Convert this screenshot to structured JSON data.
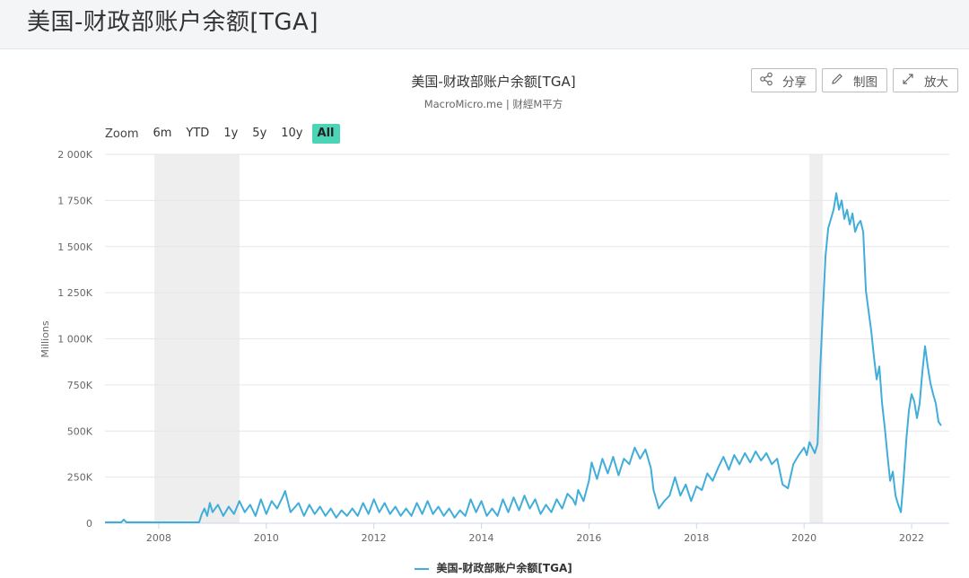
{
  "page": {
    "title": "美国-财政部账户余额[TGA]"
  },
  "toolbar": {
    "share_label": "分享",
    "draw_label": "制图",
    "enlarge_label": "放大"
  },
  "zoom": {
    "label": "Zoom",
    "options": [
      "6m",
      "YTD",
      "1y",
      "5y",
      "10y",
      "All"
    ],
    "active": "All",
    "active_color": "#4cd4b6"
  },
  "chart_data": {
    "type": "line",
    "title": "美国-财政部账户余额[TGA]",
    "subtitle": "MacroMicro.me | 财經M平方",
    "ylabel": "Millions",
    "xlabel": "",
    "ylim": [
      0,
      2000000
    ],
    "y_ticks": [
      0,
      250000,
      500000,
      750000,
      1000000,
      1250000,
      1500000,
      1750000,
      2000000
    ],
    "y_tick_labels": [
      "0",
      "250K",
      "500K",
      "750K",
      "1 000K",
      "1 250K",
      "1 500K",
      "1 750K",
      "2 000K"
    ],
    "xlim": [
      2007.0,
      2022.7
    ],
    "x_ticks": [
      2008,
      2010,
      2012,
      2014,
      2016,
      2018,
      2020,
      2022
    ],
    "x_tick_labels": [
      "2008",
      "2010",
      "2012",
      "2014",
      "2016",
      "2018",
      "2020",
      "2022"
    ],
    "grid": true,
    "legend_position": "bottom-center",
    "shaded_periods": [
      [
        2007.92,
        2009.5
      ],
      [
        2020.1,
        2020.35
      ]
    ],
    "shade_color": "#eeeeee",
    "series": [
      {
        "name": "美国-财政部账户余额[TGA]",
        "color": "#41add9",
        "points": [
          [
            2007.0,
            5000
          ],
          [
            2007.3,
            5000
          ],
          [
            2007.35,
            20000
          ],
          [
            2007.4,
            5000
          ],
          [
            2007.6,
            5000
          ],
          [
            2007.9,
            5000
          ],
          [
            2008.2,
            5000
          ],
          [
            2008.5,
            5000
          ],
          [
            2008.75,
            5000
          ],
          [
            2008.8,
            50000
          ],
          [
            2008.85,
            80000
          ],
          [
            2008.9,
            40000
          ],
          [
            2008.95,
            110000
          ],
          [
            2009.0,
            60000
          ],
          [
            2009.1,
            100000
          ],
          [
            2009.2,
            40000
          ],
          [
            2009.3,
            90000
          ],
          [
            2009.4,
            50000
          ],
          [
            2009.5,
            120000
          ],
          [
            2009.6,
            60000
          ],
          [
            2009.7,
            100000
          ],
          [
            2009.8,
            40000
          ],
          [
            2009.9,
            130000
          ],
          [
            2010.0,
            50000
          ],
          [
            2010.1,
            120000
          ],
          [
            2010.2,
            80000
          ],
          [
            2010.3,
            140000
          ],
          [
            2010.35,
            175000
          ],
          [
            2010.45,
            60000
          ],
          [
            2010.6,
            110000
          ],
          [
            2010.7,
            40000
          ],
          [
            2010.8,
            100000
          ],
          [
            2010.9,
            50000
          ],
          [
            2011.0,
            90000
          ],
          [
            2011.1,
            40000
          ],
          [
            2011.2,
            80000
          ],
          [
            2011.3,
            30000
          ],
          [
            2011.4,
            70000
          ],
          [
            2011.5,
            40000
          ],
          [
            2011.6,
            80000
          ],
          [
            2011.7,
            40000
          ],
          [
            2011.8,
            110000
          ],
          [
            2011.9,
            50000
          ],
          [
            2012.0,
            130000
          ],
          [
            2012.1,
            60000
          ],
          [
            2012.2,
            110000
          ],
          [
            2012.3,
            50000
          ],
          [
            2012.4,
            90000
          ],
          [
            2012.5,
            40000
          ],
          [
            2012.6,
            80000
          ],
          [
            2012.7,
            40000
          ],
          [
            2012.8,
            110000
          ],
          [
            2012.9,
            50000
          ],
          [
            2013.0,
            120000
          ],
          [
            2013.1,
            50000
          ],
          [
            2013.2,
            90000
          ],
          [
            2013.3,
            40000
          ],
          [
            2013.4,
            80000
          ],
          [
            2013.5,
            30000
          ],
          [
            2013.6,
            70000
          ],
          [
            2013.7,
            40000
          ],
          [
            2013.8,
            130000
          ],
          [
            2013.9,
            60000
          ],
          [
            2014.0,
            120000
          ],
          [
            2014.1,
            40000
          ],
          [
            2014.2,
            80000
          ],
          [
            2014.3,
            40000
          ],
          [
            2014.4,
            130000
          ],
          [
            2014.5,
            60000
          ],
          [
            2014.6,
            140000
          ],
          [
            2014.7,
            70000
          ],
          [
            2014.8,
            150000
          ],
          [
            2014.9,
            80000
          ],
          [
            2015.0,
            130000
          ],
          [
            2015.1,
            50000
          ],
          [
            2015.2,
            100000
          ],
          [
            2015.3,
            60000
          ],
          [
            2015.4,
            130000
          ],
          [
            2015.5,
            80000
          ],
          [
            2015.6,
            160000
          ],
          [
            2015.7,
            130000
          ],
          [
            2015.75,
            100000
          ],
          [
            2015.8,
            180000
          ],
          [
            2015.9,
            120000
          ],
          [
            2016.0,
            230000
          ],
          [
            2016.05,
            330000
          ],
          [
            2016.15,
            240000
          ],
          [
            2016.25,
            350000
          ],
          [
            2016.35,
            270000
          ],
          [
            2016.45,
            360000
          ],
          [
            2016.55,
            260000
          ],
          [
            2016.65,
            350000
          ],
          [
            2016.75,
            320000
          ],
          [
            2016.85,
            410000
          ],
          [
            2016.95,
            350000
          ],
          [
            2017.05,
            400000
          ],
          [
            2017.15,
            300000
          ],
          [
            2017.2,
            180000
          ],
          [
            2017.3,
            80000
          ],
          [
            2017.4,
            120000
          ],
          [
            2017.5,
            150000
          ],
          [
            2017.6,
            250000
          ],
          [
            2017.7,
            150000
          ],
          [
            2017.8,
            210000
          ],
          [
            2017.9,
            120000
          ],
          [
            2018.0,
            200000
          ],
          [
            2018.1,
            180000
          ],
          [
            2018.2,
            270000
          ],
          [
            2018.3,
            230000
          ],
          [
            2018.4,
            300000
          ],
          [
            2018.5,
            360000
          ],
          [
            2018.6,
            290000
          ],
          [
            2018.7,
            370000
          ],
          [
            2018.8,
            320000
          ],
          [
            2018.9,
            380000
          ],
          [
            2019.0,
            330000
          ],
          [
            2019.1,
            390000
          ],
          [
            2019.2,
            340000
          ],
          [
            2019.3,
            380000
          ],
          [
            2019.4,
            320000
          ],
          [
            2019.5,
            350000
          ],
          [
            2019.6,
            210000
          ],
          [
            2019.7,
            190000
          ],
          [
            2019.8,
            320000
          ],
          [
            2019.9,
            370000
          ],
          [
            2020.0,
            410000
          ],
          [
            2020.05,
            370000
          ],
          [
            2020.1,
            440000
          ],
          [
            2020.2,
            380000
          ],
          [
            2020.25,
            430000
          ],
          [
            2020.3,
            840000
          ],
          [
            2020.35,
            1150000
          ],
          [
            2020.4,
            1450000
          ],
          [
            2020.45,
            1600000
          ],
          [
            2020.5,
            1650000
          ],
          [
            2020.55,
            1700000
          ],
          [
            2020.6,
            1790000
          ],
          [
            2020.65,
            1700000
          ],
          [
            2020.7,
            1750000
          ],
          [
            2020.75,
            1650000
          ],
          [
            2020.8,
            1700000
          ],
          [
            2020.85,
            1620000
          ],
          [
            2020.9,
            1680000
          ],
          [
            2020.95,
            1580000
          ],
          [
            2021.0,
            1620000
          ],
          [
            2021.05,
            1640000
          ],
          [
            2021.1,
            1580000
          ],
          [
            2021.15,
            1260000
          ],
          [
            2021.2,
            1150000
          ],
          [
            2021.25,
            1040000
          ],
          [
            2021.3,
            900000
          ],
          [
            2021.35,
            780000
          ],
          [
            2021.4,
            850000
          ],
          [
            2021.45,
            650000
          ],
          [
            2021.5,
            520000
          ],
          [
            2021.55,
            370000
          ],
          [
            2021.6,
            230000
          ],
          [
            2021.65,
            280000
          ],
          [
            2021.7,
            150000
          ],
          [
            2021.75,
            100000
          ],
          [
            2021.8,
            60000
          ],
          [
            2021.85,
            240000
          ],
          [
            2021.9,
            450000
          ],
          [
            2021.95,
            610000
          ],
          [
            2022.0,
            700000
          ],
          [
            2022.05,
            660000
          ],
          [
            2022.1,
            570000
          ],
          [
            2022.15,
            650000
          ],
          [
            2022.2,
            820000
          ],
          [
            2022.25,
            960000
          ],
          [
            2022.3,
            850000
          ],
          [
            2022.35,
            760000
          ],
          [
            2022.4,
            700000
          ],
          [
            2022.45,
            650000
          ],
          [
            2022.5,
            550000
          ],
          [
            2022.55,
            530000
          ]
        ]
      }
    ]
  }
}
